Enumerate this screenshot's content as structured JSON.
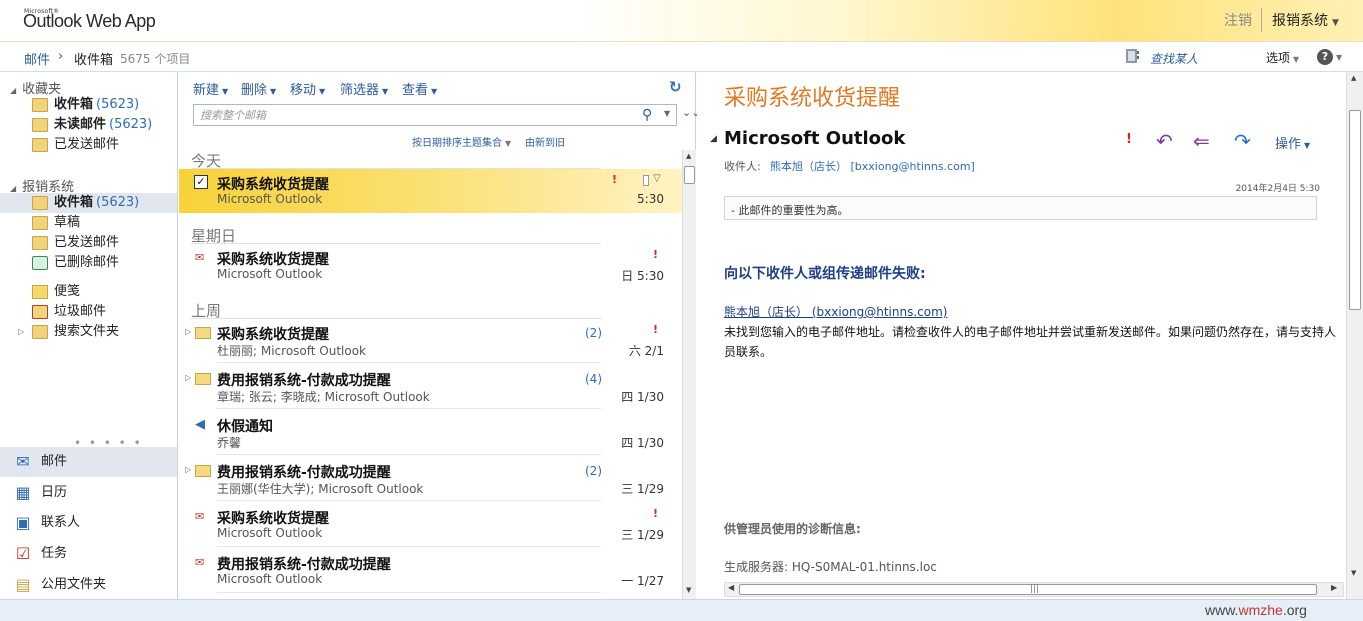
{
  "app": {
    "logo_small": "Microsoft®",
    "logo": "Outlook Web App",
    "signout": "注销",
    "username": "报销系统"
  },
  "crumb": {
    "mail": "邮件",
    "inbox": "收件箱",
    "count": "5675 个项目",
    "find_person": "查找某人",
    "options": "选项",
    "help": "?"
  },
  "nav": {
    "favorites_title": "收藏夹",
    "favorites": [
      {
        "label": "收件箱",
        "count": "(5623)",
        "bold": true,
        "icon": "inbox-folder-icon"
      },
      {
        "label": "未读邮件",
        "count": "(5623)",
        "bold": true,
        "icon": "search-folder-icon"
      },
      {
        "label": "已发送邮件",
        "count": "",
        "bold": false,
        "icon": "sent-folder-icon"
      }
    ],
    "mailbox_title": "报销系统",
    "mailbox": [
      {
        "label": "收件箱",
        "count": "(5623)",
        "bold": true,
        "icon": "inbox-folder-icon"
      },
      {
        "label": "草稿",
        "count": "",
        "bold": false,
        "icon": "drafts-folder-icon"
      },
      {
        "label": "已发送邮件",
        "count": "",
        "bold": false,
        "icon": "sent-folder-icon"
      },
      {
        "label": "已删除邮件",
        "count": "",
        "bold": false,
        "icon": "deleted-folder-icon"
      },
      {
        "label": "便笺",
        "count": "",
        "bold": false,
        "icon": "notes-folder-icon"
      },
      {
        "label": "垃圾邮件",
        "count": "",
        "bold": false,
        "icon": "junk-folder-icon"
      },
      {
        "label": "搜索文件夹",
        "count": "",
        "bold": false,
        "icon": "search-folders-icon"
      }
    ],
    "dots": "• • • • •",
    "modules": [
      {
        "label": "邮件",
        "icon": "mail-icon"
      },
      {
        "label": "日历",
        "icon": "calendar-icon"
      },
      {
        "label": "联系人",
        "icon": "contacts-icon"
      },
      {
        "label": "任务",
        "icon": "tasks-icon"
      },
      {
        "label": "公用文件夹",
        "icon": "public-folder-icon"
      }
    ]
  },
  "list": {
    "toolbar": {
      "new": "新建",
      "delete": "删除",
      "move": "移动",
      "filter": "筛选器",
      "view": "查看"
    },
    "search_placeholder": "搜索整个邮箱",
    "sort_label": "按日期排序主题集合",
    "sort_order": "由新到旧",
    "groups": [
      "今天",
      "星期日",
      "上周"
    ],
    "messages": [
      {
        "subject": "采购系统收货提醒",
        "from": "Microsoft Outlook",
        "time": "5:30",
        "count": "",
        "important": true,
        "icon": "checkbox-icon"
      },
      {
        "subject": "采购系统收货提醒",
        "from": "Microsoft Outlook",
        "time": "日 5:30",
        "count": "",
        "important": true,
        "icon": "undeliverable-icon"
      },
      {
        "subject": "采购系统收货提醒",
        "from": "杜丽丽; Microsoft Outlook",
        "time": "六 2/1",
        "count": "(2)",
        "important": true,
        "icon": "conversation-envelope-icon"
      },
      {
        "subject": "费用报销系统-付款成功提醒",
        "from": "章瑞; 张云; 李晓成; Microsoft Outlook",
        "time": "四 1/30",
        "count": "(4)",
        "important": false,
        "icon": "conversation-envelope-icon"
      },
      {
        "subject": "休假通知",
        "from": "乔馨",
        "time": "四 1/30",
        "count": "",
        "important": false,
        "icon": "reply-envelope-icon"
      },
      {
        "subject": "费用报销系统-付款成功提醒",
        "from": "王丽娜(华住大学); Microsoft Outlook",
        "time": "三 1/29",
        "count": "(2)",
        "important": false,
        "icon": "conversation-envelope-icon"
      },
      {
        "subject": "采购系统收货提醒",
        "from": "Microsoft Outlook",
        "time": "三 1/29",
        "count": "",
        "important": true,
        "icon": "undeliverable-icon"
      },
      {
        "subject": "费用报销系统-付款成功提醒",
        "from": "Microsoft Outlook",
        "time": "一 1/27",
        "count": "",
        "important": false,
        "icon": "undeliverable-icon"
      }
    ]
  },
  "reading": {
    "title": "采购系统收货提醒",
    "sender": "Microsoft Outlook",
    "actions": "操作",
    "to_label": "收件人:",
    "to": "熊本旭（店长） [bxxiong@htinns.com]",
    "date": "2014年2月4日 5:30",
    "notice": "- 此邮件的重要性为高。",
    "heading": "向以下收件人或组传递邮件失败:",
    "recipient": "熊本旭（店长） (bxxiong@htinns.com)",
    "body": "未找到您输入的电子邮件地址。请检查收件人的电子邮件地址并尝试重新发送邮件。如果问题仍然存在，请与支持人员联系。",
    "diag_title": "供管理员使用的诊断信息:",
    "server": "生成服务器: HQ-S0MAL-01.htinns.loc"
  },
  "watermark": {
    "prefix": "www.",
    "brand": "wmzhe",
    "suffix": ".org"
  },
  "colors": {
    "accent": "#2f5d9b",
    "title_orange": "#e07a23",
    "selected_yellow": "#f7d238",
    "important_red": "#d2281f"
  }
}
